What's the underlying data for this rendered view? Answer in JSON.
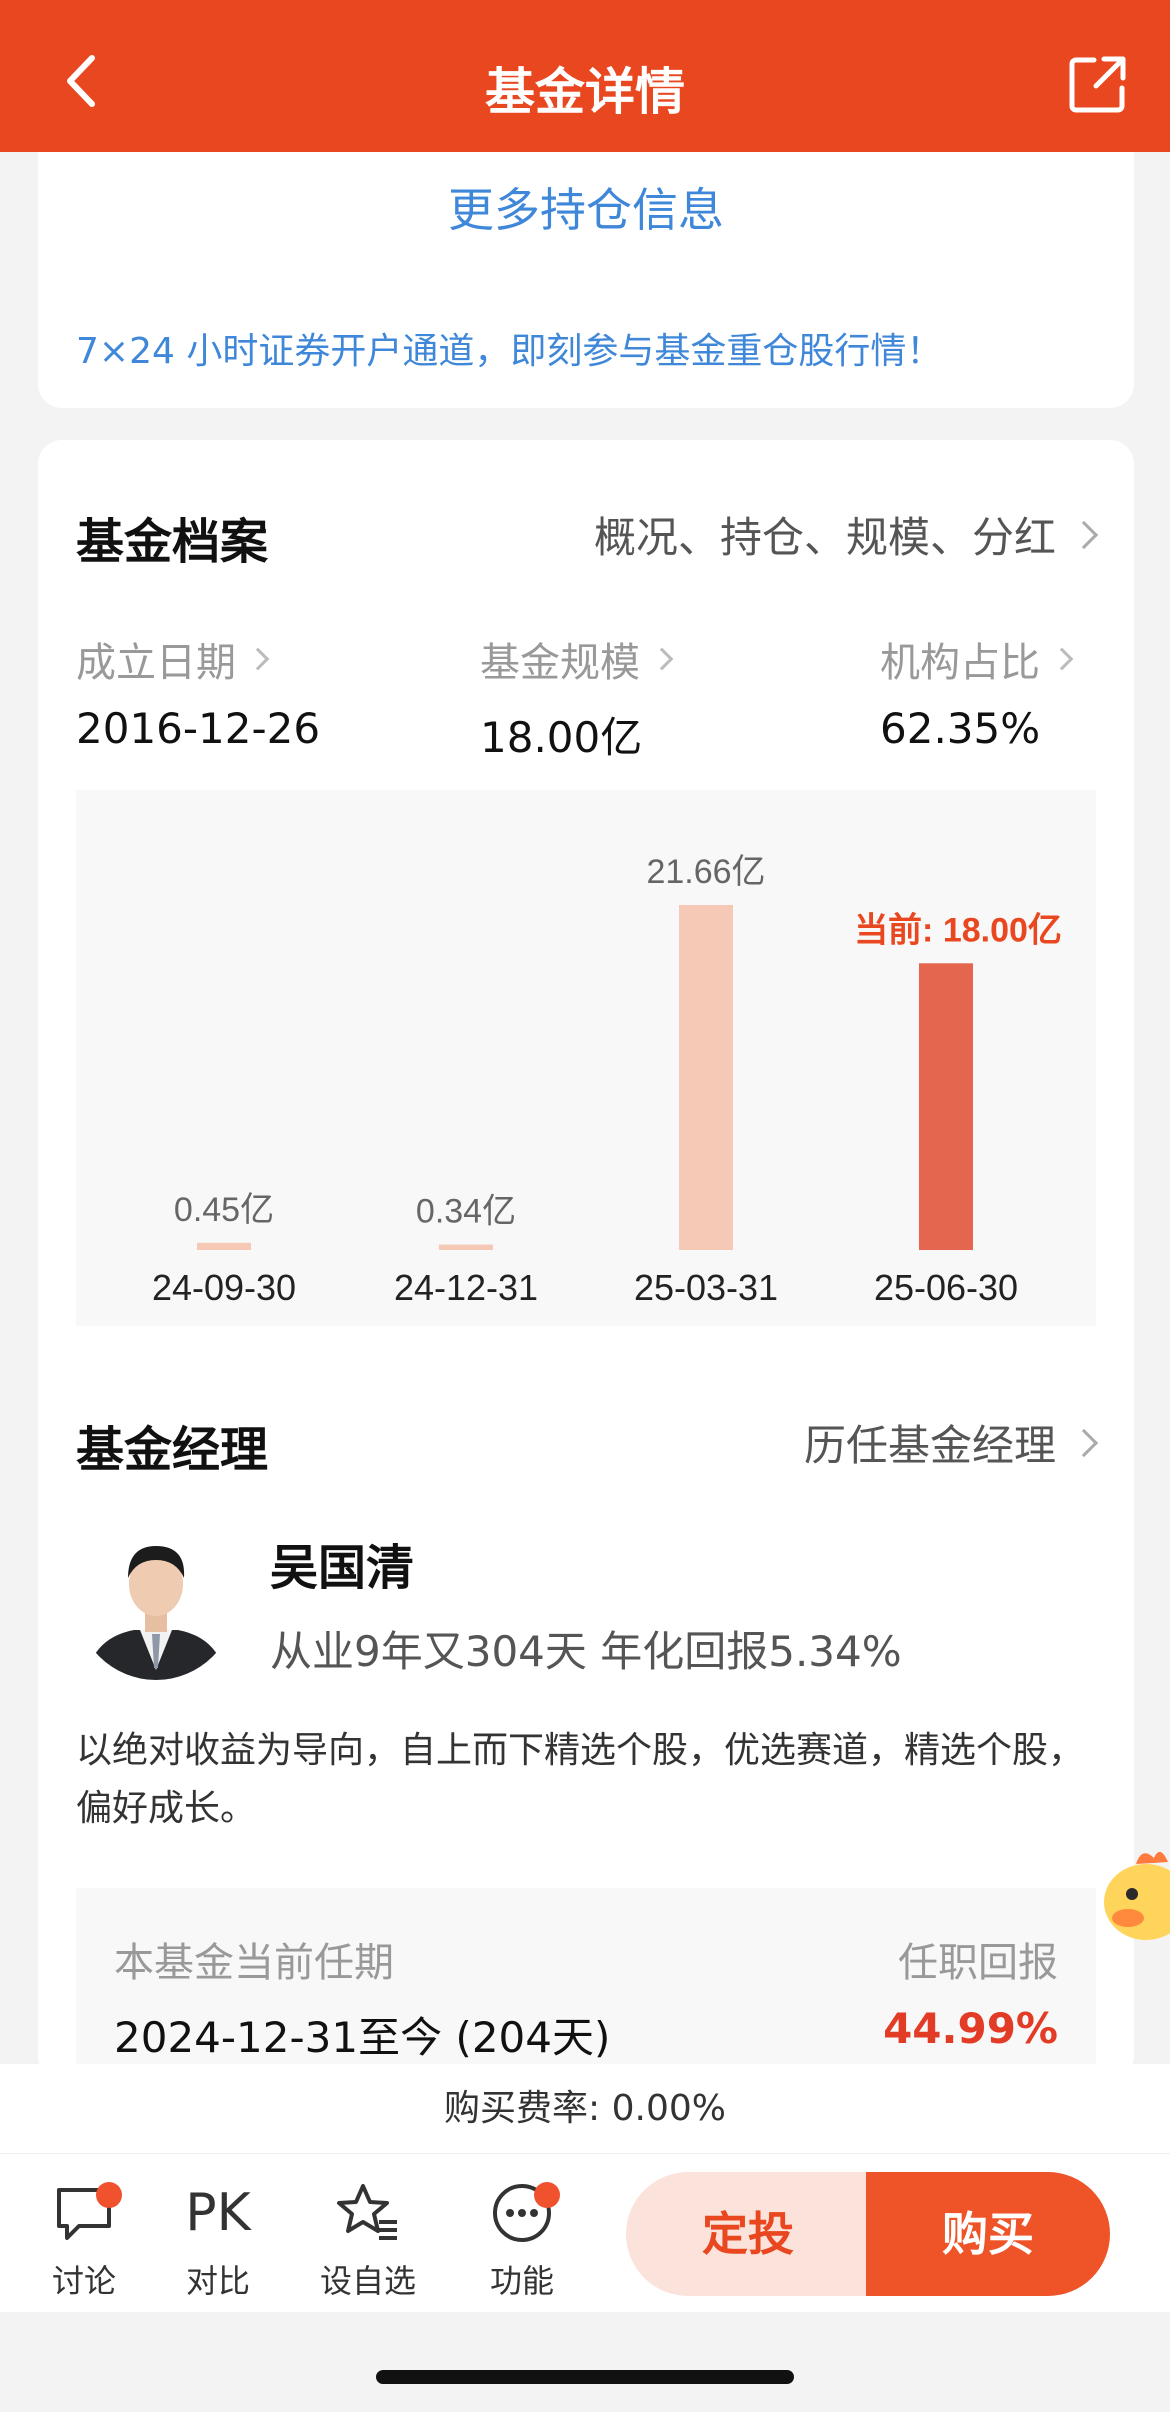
{
  "header": {
    "title": "基金详情",
    "back_icon": "back-arrow-icon",
    "share_icon": "share-icon"
  },
  "holdings": {
    "more_link": "更多持仓信息",
    "promo": "7×24 小时证券开户通道，即刻参与基金重仓股行情！"
  },
  "profile": {
    "title": "基金档案",
    "link": "概况、持仓、规模、分红",
    "stats": [
      {
        "label": "成立日期",
        "value": "2016-12-26"
      },
      {
        "label": "基金规模",
        "value": "18.00亿"
      },
      {
        "label": "机构占比",
        "value": "62.35%"
      }
    ]
  },
  "chart_data": {
    "type": "bar",
    "categories": [
      "24-09-30",
      "24-12-31",
      "25-03-31",
      "25-06-30"
    ],
    "values": [
      0.45,
      0.34,
      21.66,
      18.0
    ],
    "data_labels": [
      "0.45亿",
      "0.34亿",
      "21.66亿",
      "当前: 18.00亿"
    ],
    "unit": "亿",
    "colors": {
      "past": "#f5c9b5",
      "current": "#e5664f",
      "current_label": "#e9471f"
    }
  },
  "manager": {
    "title": "基金经理",
    "link": "历任基金经理",
    "name": "吴国清",
    "info": "从业9年又304天 年化回报5.34%",
    "description": "以绝对收益为导向，自上而下精选个股，优选赛道，精选个股，偏好成长。",
    "tenure": {
      "label": "本基金当前任期",
      "return_label": "任职回报",
      "period": "2024-12-31至今 (204天)",
      "return_value": "44.99%"
    }
  },
  "fee": "购买费率: 0.00%",
  "toolbar": {
    "items": [
      {
        "label": "讨论",
        "icon": "chat-bubble-icon"
      },
      {
        "label": "对比",
        "icon": "pk-icon",
        "icon_text": "PK"
      },
      {
        "label": "设自选",
        "icon": "star-list-icon"
      },
      {
        "label": "功能",
        "icon": "more-dots-icon"
      }
    ],
    "sip_label": "定投",
    "buy_label": "购买"
  },
  "colors": {
    "brand": "#e9471f",
    "link": "#3f87d8",
    "positive": "#e23b26"
  }
}
